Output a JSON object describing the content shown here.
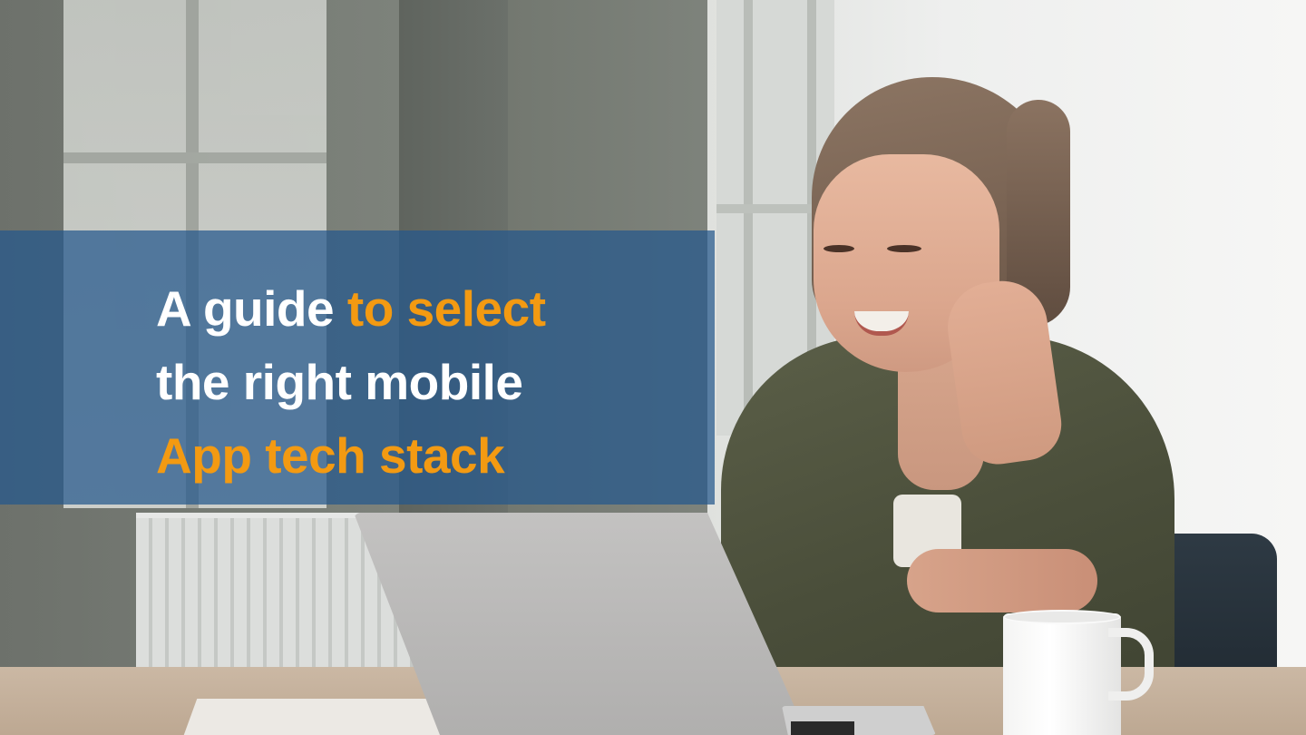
{
  "headline": {
    "line1_white": "A guide ",
    "line1_orange": "to select",
    "line2_white": "the right mobile",
    "line3_orange": "App tech stack"
  },
  "colors": {
    "banner": "#24588c",
    "accent": "#f39a12",
    "text": "#ffffff"
  }
}
